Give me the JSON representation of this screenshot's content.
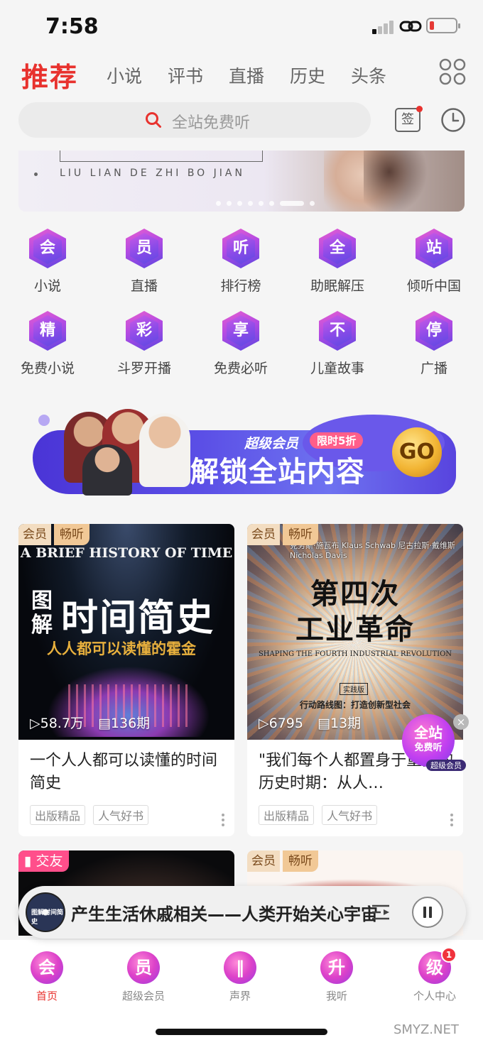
{
  "status_bar": {
    "time": "7:58"
  },
  "tabs": {
    "active": "推荐",
    "items": [
      "小说",
      "评书",
      "直播",
      "历史",
      "头条"
    ]
  },
  "search": {
    "placeholder": "全站免费听",
    "checkin_label": "签"
  },
  "banner": {
    "caption": "LIU LIAN DE ZHI BO JIAN"
  },
  "categories": [
    {
      "icon_char": "会",
      "label": "小说"
    },
    {
      "icon_char": "员",
      "label": "直播"
    },
    {
      "icon_char": "听",
      "label": "排行榜"
    },
    {
      "icon_char": "全",
      "label": "助眠解压"
    },
    {
      "icon_char": "站",
      "label": "倾听中国"
    },
    {
      "icon_char": "精",
      "label": "免费小说"
    },
    {
      "icon_char": "彩",
      "label": "斗罗开播"
    },
    {
      "icon_char": "享",
      "label": "免费必听"
    },
    {
      "icon_char": "不",
      "label": "儿童故事"
    },
    {
      "icon_char": "停",
      "label": "广播"
    }
  ],
  "promo": {
    "tag": "超级会员",
    "discount": "限时5折",
    "headline": "解锁全站内容",
    "go": "GO"
  },
  "cards": [
    {
      "badge_vip": "会员",
      "badge_hot": "畅听",
      "cover_en": "A BRIEF HISTORY OF TIME",
      "cover_tu": "图解",
      "cover_main": "时间简史",
      "cover_sub": "人人都可以读懂的霍金",
      "plays": "▷58.7万",
      "episodes": "▤136期",
      "title": "一个人人都可以读懂的时间简史",
      "tags": [
        "出版精品",
        "人气好书"
      ]
    },
    {
      "badge_vip": "会员",
      "badge_hot": "畅听",
      "cover_authors": "克劳斯·施瓦布 Klaus Schwab  尼古拉斯·戴维斯 Nicholas Davis",
      "cover_main_1": "第四次",
      "cover_main_2": "工业革命",
      "cover_en": "SHAPING THE FOURTH INDUSTRIAL REVOLUTION",
      "cover_edition": "实践版",
      "cover_foot": "行动路线图：打造创新型社会",
      "plays": "▷6795",
      "episodes": "▤13期",
      "title": "\"我们每个人都置身于重要的历史时期：从人…",
      "tags": [
        "出版精品",
        "人气好书"
      ]
    }
  ],
  "float_free": {
    "line1": "全站",
    "line2": "免费听",
    "tag": "超级会员",
    "close": "×"
  },
  "row2": {
    "left_badge": "交友",
    "right_badge_vip": "会员",
    "right_badge_hot": "畅听"
  },
  "player": {
    "disc_label": "图解时间简史",
    "ticker": "产生生活休戚相关——人类开始关心宇宙"
  },
  "bottom_nav": [
    {
      "icon_char": "会",
      "label": "首页"
    },
    {
      "icon_char": "员",
      "label": "超级会员"
    },
    {
      "icon_char": "‖",
      "label": "声界"
    },
    {
      "icon_char": "升",
      "label": "我听"
    },
    {
      "icon_char": "级",
      "label": "个人中心",
      "badge": "1"
    }
  ],
  "watermark": "SMYZ.NET",
  "colors": {
    "accent": "#e8322e",
    "brand_purple": "#7b3de6",
    "badge_pink": "#ff4f8b"
  }
}
